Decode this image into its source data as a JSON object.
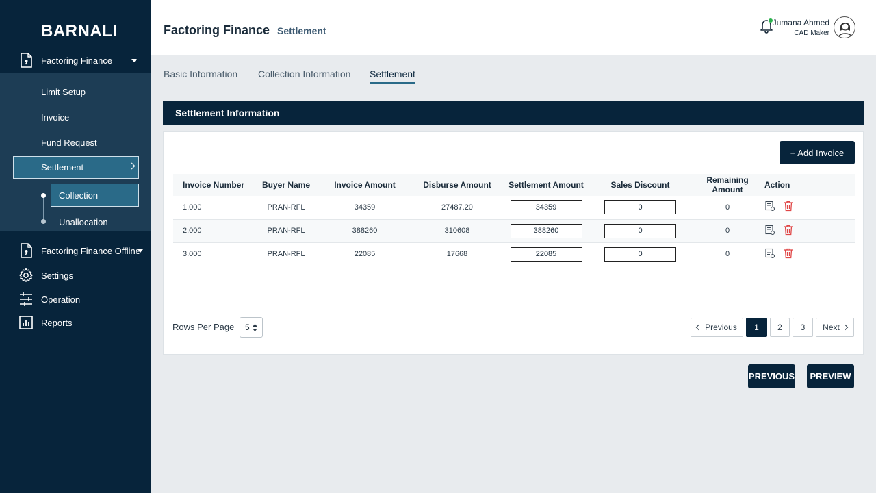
{
  "brand": "BARNALI",
  "sidebar": {
    "group1": {
      "label": "Factoring Finance",
      "icon": "document-icon"
    },
    "sub_items": [
      "Limit Setup",
      "Invoice",
      "Fund Request"
    ],
    "active_item": "Settlement",
    "active_child": "Collection",
    "child2": "Unallocation",
    "group2": {
      "label": "Factoring Finance Offline",
      "icon": "document-icon"
    },
    "settings": {
      "label": "Settings",
      "icon": "gear-icon"
    },
    "operation": {
      "label": "Operation",
      "icon": "sliders-icon"
    },
    "reports": {
      "label": "Reports",
      "icon": "chart-icon"
    }
  },
  "header": {
    "title": "Factoring Finance",
    "subtitle": "Settlement",
    "user_name": "Jumana Ahmed",
    "user_role": "CAD Maker"
  },
  "tabs": [
    "Basic Information",
    "Collection Information",
    "Settlement"
  ],
  "section_title": "Settlement Information",
  "add_button": "+ Add Invoice",
  "table": {
    "headers": [
      "Invoice Number",
      "Buyer Name",
      "Invoice Amount",
      "Disburse Amount",
      "Settlement Amount",
      "Sales Discount",
      "Remaining Amount",
      "Action"
    ],
    "rows": [
      {
        "invoice_number": "1.000",
        "buyer": "PRAN-RFL",
        "invoice_amount": "34359",
        "disburse_amount": "27487.20",
        "settlement_amount": "34359",
        "sales_discount": "0",
        "remaining": "0"
      },
      {
        "invoice_number": "2.000",
        "buyer": "PRAN-RFL",
        "invoice_amount": "388260",
        "disburse_amount": "310608",
        "settlement_amount": "388260",
        "sales_discount": "0",
        "remaining": "0"
      },
      {
        "invoice_number": "3.000",
        "buyer": "PRAN-RFL",
        "invoice_amount": "22085",
        "disburse_amount": "17668",
        "settlement_amount": "22085",
        "sales_discount": "0",
        "remaining": "0"
      }
    ]
  },
  "pagination": {
    "rows_label": "Rows Per Page",
    "rows_value": "5",
    "previous": "Previous",
    "pages": [
      "1",
      "2",
      "3"
    ],
    "next": "Next"
  },
  "footer": {
    "previous": "PREVIOUS",
    "preview": "PREVIEW"
  },
  "colors": {
    "sidebar": "#07243b",
    "active": "#2a6a88",
    "delete": "#e04646"
  }
}
